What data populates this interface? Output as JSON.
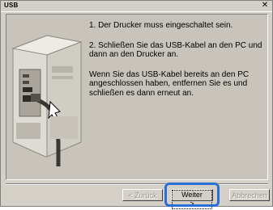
{
  "window": {
    "title": "USB",
    "close_glyph": "✕"
  },
  "instructions": [
    {
      "text": "1. Der Drucker muss eingeschaltet sein."
    },
    {
      "text": "2. Schließen Sie das USB-Kabel an den PC und dann an den Drucker an."
    },
    {
      "text": "Wenn Sie das USB-Kabel bereits an den PC angeschlossen haben, entfernen Sie es und schließen es dann erneut an."
    }
  ],
  "buttons": {
    "back": "< Zurück",
    "next": "Weiter >",
    "cancel": "Abbrechen"
  },
  "illustration": {
    "icon": "printer-usb-connection-icon"
  },
  "colors": {
    "highlight": "#2a6fd8"
  }
}
